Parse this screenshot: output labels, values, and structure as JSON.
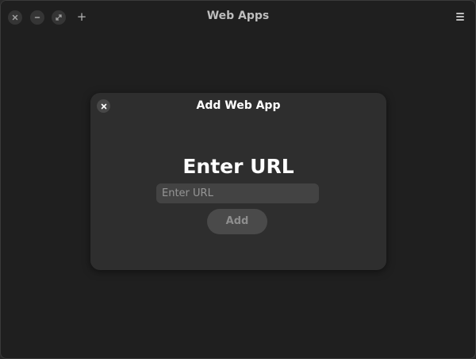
{
  "window": {
    "title": "Web Apps",
    "new_symbol": "+"
  },
  "dialog": {
    "title": "Add Web App",
    "heading": "Enter URL",
    "input_placeholder": "Enter URL",
    "input_value": "",
    "add_label": "Add"
  },
  "icons": [
    "close-icon",
    "minimize-icon",
    "maximize-icon",
    "plus-icon",
    "hamburger-menu-icon"
  ],
  "colors": {
    "window_bg": "#1f1f1f",
    "dialog_bg": "#2e2e2e",
    "input_bg": "#434343",
    "button_bg": "#4a4a4a",
    "text_primary": "#ffffff",
    "text_muted": "#bdbdbd"
  }
}
